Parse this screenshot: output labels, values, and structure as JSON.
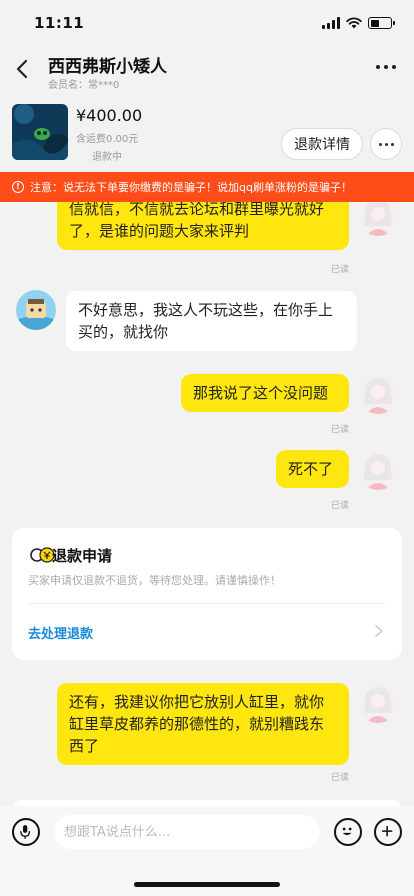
{
  "status_bar": {
    "time": "11:11"
  },
  "header": {
    "title": "西西弗斯小矮人",
    "subtitle": "会员名：常***0"
  },
  "product": {
    "price": "¥400.00",
    "shipping": "含运费0.00元",
    "status": "退款中",
    "refund_detail_label": "退款详情"
  },
  "warning": {
    "text": "注意：说无法下单要你缴费的是骗子！说加qq刷单涨粉的是骗子！"
  },
  "messages": [
    {
      "side": "me",
      "text": "信就信，不信就去论坛和群里曝光就好了，是谁的问题大家来评判",
      "read": "已读"
    },
    {
      "side": "other",
      "text": "不好意思，我这人不玩这些，在你手上买的，就找你"
    },
    {
      "side": "me",
      "text": "那我说了这个没问题",
      "read": "已读"
    },
    {
      "side": "me",
      "text": "死不了",
      "read": "已读"
    },
    {
      "side": "me",
      "text": "还有，我建议你把它放别人缸里，就你缸里草皮都养的那德性的，就别糟践东西了",
      "read": "已读"
    }
  ],
  "refund_card": {
    "title": "退款申请",
    "description": "买家申请仅退款不退货，等待您处理。请谨慎操作！",
    "action_label": "去处理退款"
  },
  "input_bar": {
    "placeholder": "想跟TA说点什么..."
  }
}
